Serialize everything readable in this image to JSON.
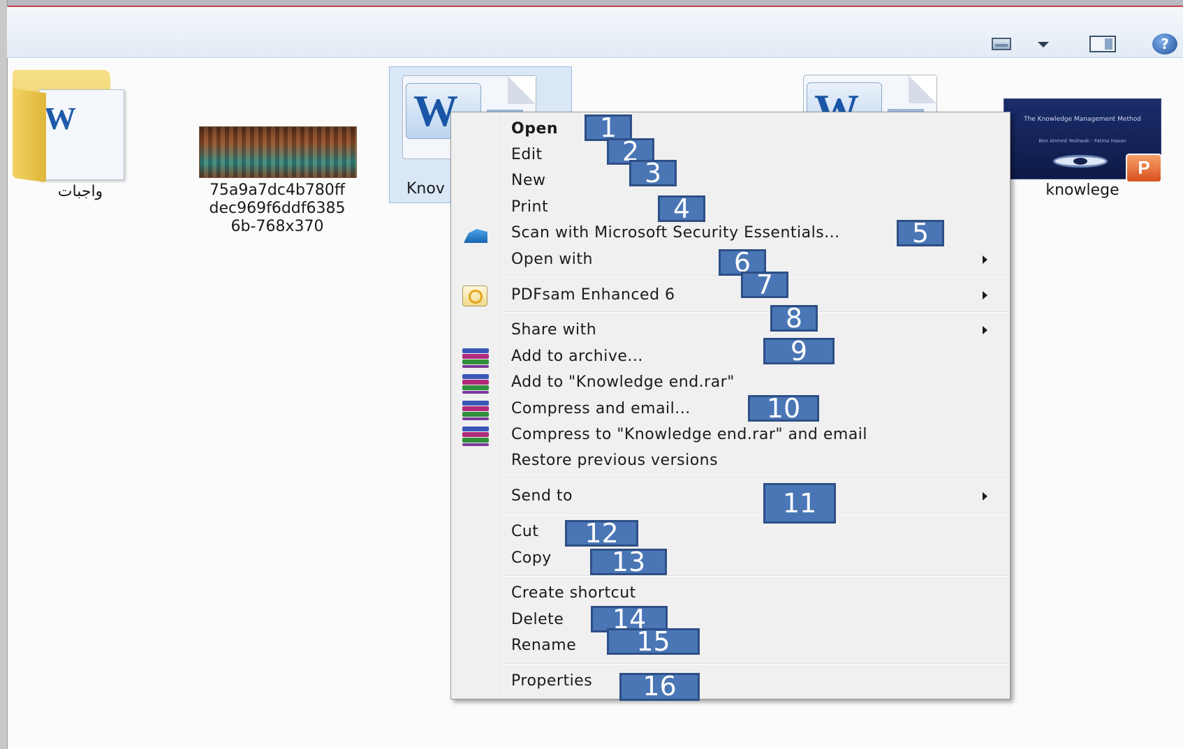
{
  "files": [
    {
      "name": "واجبات"
    },
    {
      "name_lines": [
        "75a9a7dc4b780ff",
        "dec969f6ddf6385",
        "6b-768x370"
      ]
    },
    {
      "name_visible": "Knov"
    },
    {
      "name": "knowlege"
    }
  ],
  "ppt_thumb": {
    "title": "The Knowledge Management Method",
    "authors": "Ben Ahmed Yeshwak - Fatma Hasan",
    "badge": "P"
  },
  "toolbar": {
    "view_icon": "change-view-icon",
    "dropdown_icon": "chevron-down-icon",
    "preview_icon": "preview-pane-icon",
    "help_label": "?"
  },
  "menu": {
    "items": [
      {
        "label": "Open",
        "bold": true
      },
      {
        "label": "Edit"
      },
      {
        "label": "New"
      },
      {
        "label": "Print"
      },
      {
        "label": "Scan with Microsoft Security Essentials...",
        "icon": "security-essentials-icon"
      },
      {
        "label": "Open with",
        "submenu": true
      },
      {
        "label": "PDFsam Enhanced 6",
        "icon": "pdfsam-icon",
        "submenu": true
      },
      {
        "label": "Share with",
        "submenu": true
      },
      {
        "label": "Add to archive...",
        "icon": "winrar-icon"
      },
      {
        "label": "Add to \"Knowledge end.rar\"",
        "icon": "winrar-icon"
      },
      {
        "label": "Compress and email...",
        "icon": "winrar-icon"
      },
      {
        "label": "Compress to \"Knowledge end.rar\" and email",
        "icon": "winrar-icon"
      },
      {
        "label": "Restore previous versions"
      },
      {
        "label": "Send to",
        "submenu": true
      },
      {
        "label": "Cut"
      },
      {
        "label": "Copy"
      },
      {
        "label": "Create shortcut"
      },
      {
        "label": "Delete"
      },
      {
        "label": "Rename"
      },
      {
        "label": "Properties"
      }
    ]
  },
  "badges": [
    "1",
    "2",
    "3",
    "4",
    "5",
    "6",
    "7",
    "8",
    "9",
    "10",
    "11",
    "12",
    "13",
    "14",
    "15",
    "16"
  ],
  "colors": {
    "badge_fill": "#4a76b6",
    "badge_border": "#2e4f86",
    "menu_bg": "#f0f0f0"
  }
}
